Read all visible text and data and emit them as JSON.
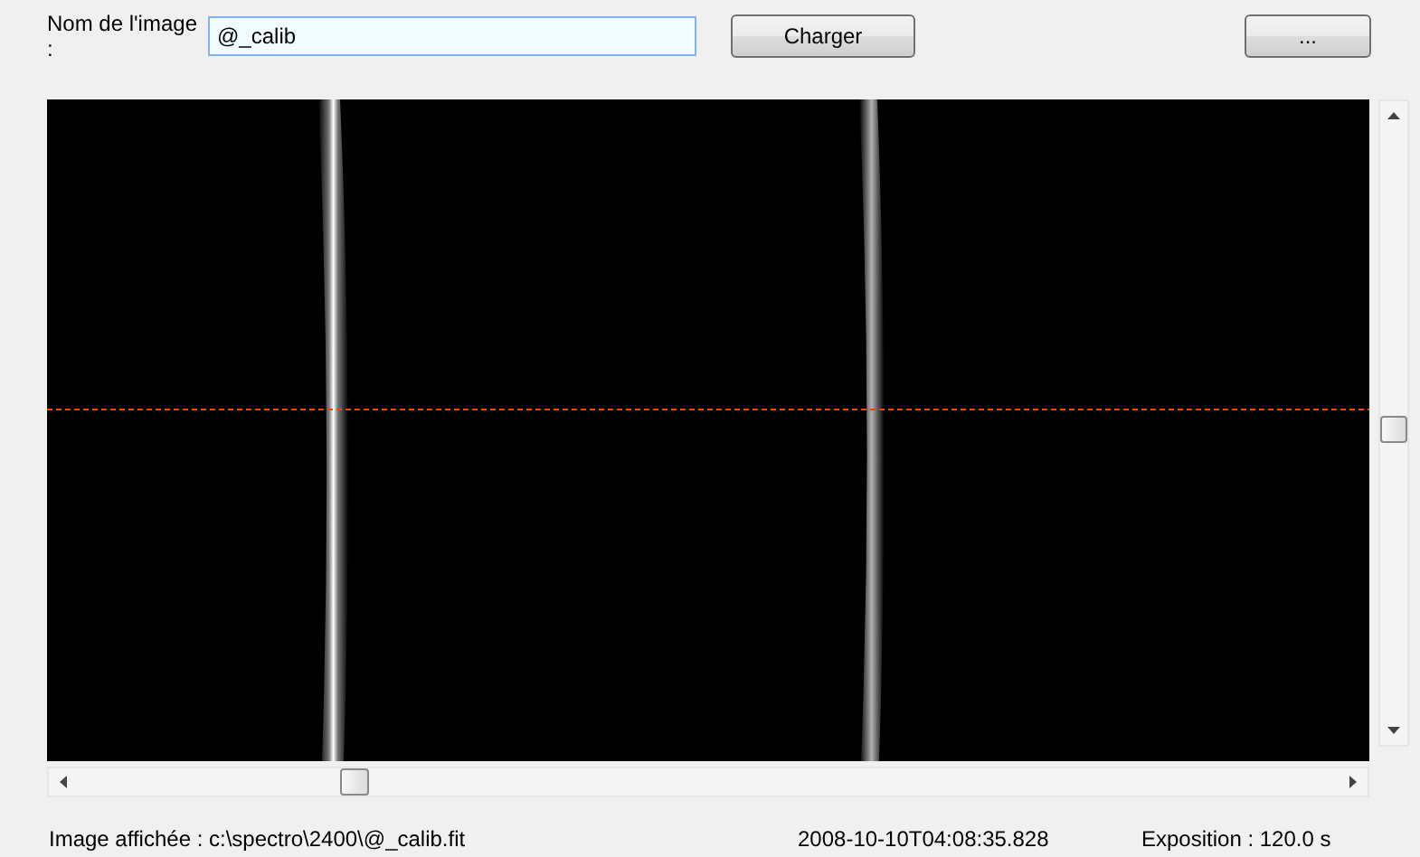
{
  "image_name": {
    "label": "Nom de l'image :",
    "value": "@_calib"
  },
  "buttons": [
    "Charger",
    "..."
  ],
  "status_bar": {
    "displayed_image": "Image affichée : c:\\spectro\\2400\\@_calib.fit",
    "timestamp": "2008-10-10T04:08:35.828",
    "exposure": "Exposition : 120.0 s"
  }
}
